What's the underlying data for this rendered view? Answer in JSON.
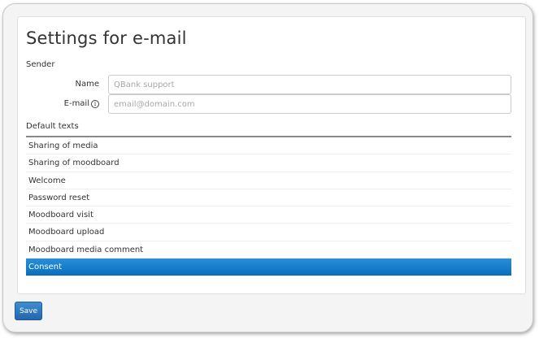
{
  "page": {
    "title": "Settings for e-mail"
  },
  "sender": {
    "section_label": "Sender",
    "name_label": "Name",
    "name_placeholder": "QBank support",
    "name_value": "",
    "email_label": "E-mail",
    "email_info_icon": "info-circle-icon",
    "email_placeholder": "email@domain.com",
    "email_value": ""
  },
  "default_texts": {
    "section_label": "Default texts",
    "items": [
      {
        "label": "Sharing of media",
        "selected": false
      },
      {
        "label": "Sharing of moodboard",
        "selected": false
      },
      {
        "label": "Welcome",
        "selected": false
      },
      {
        "label": "Password reset",
        "selected": false
      },
      {
        "label": "Moodboard visit",
        "selected": false
      },
      {
        "label": "Moodboard upload",
        "selected": false
      },
      {
        "label": "Moodboard media comment",
        "selected": false
      },
      {
        "label": "Consent",
        "selected": true
      }
    ]
  },
  "actions": {
    "save_label": "Save"
  },
  "colors": {
    "selected_row": "#0a6fc0",
    "save_button": "#2a74bd"
  }
}
